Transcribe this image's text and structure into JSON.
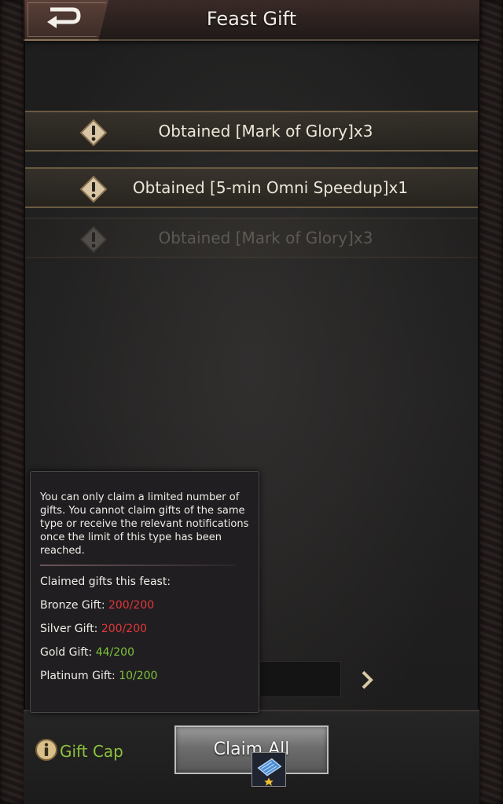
{
  "header": {
    "title": "Feast Gift"
  },
  "notifications": [
    {
      "text": "Obtained [Mark of Glory]x3"
    },
    {
      "text": "Obtained [5-min Omni Speedup]x1"
    },
    {
      "text": "Obtained [Mark of Glory]x3"
    }
  ],
  "tooltip": {
    "description": "You can only claim a limited number of gifts. You cannot claim gifts of the same type or receive the relevant notifications once the limit of this type has been reached.",
    "heading": "Claimed gifts this feast:",
    "gifts": [
      {
        "label": "Bronze Gift: ",
        "value": "200/200"
      },
      {
        "label": "Silver Gift: ",
        "value": "200/200"
      },
      {
        "label": "Gold Gift: ",
        "value": "44/200"
      },
      {
        "label": "Platinum Gift: ",
        "value": "10/200"
      }
    ]
  },
  "footer": {
    "gift_cap_label": "Gift Cap",
    "claim_all_label": "Claim All"
  },
  "colors": {
    "limit_reached": "#e2373a",
    "under_limit": "#7fc33a",
    "gift_cap_link": "#8cc23d"
  }
}
